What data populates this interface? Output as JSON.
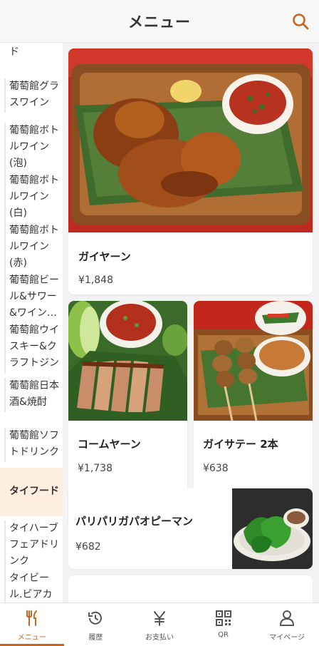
{
  "header": {
    "title": "メニュー",
    "search_icon": "search-icon"
  },
  "colors": {
    "accent": "#c8651e",
    "active_bg": "#fdeee0"
  },
  "sidebar": {
    "items": [
      {
        "label": "ド"
      },
      {
        "label": "葡萄館グラスワイン"
      },
      {
        "label": "葡萄館ボトルワイン(泡)"
      },
      {
        "label": "葡萄館ボトルワイン(白)"
      },
      {
        "label": "葡萄館ボトルワイン(赤)"
      },
      {
        "label": "葡萄館ビール&サワー&ワイン…"
      },
      {
        "label": "葡萄館ウイスキー&クラフトジン"
      },
      {
        "label": "葡萄館日本酒&焼酎"
      },
      {
        "label": "葡萄館ソフトドリンク"
      },
      {
        "label": "タイフード"
      },
      {
        "label": "タイハーブフェアドリンク"
      },
      {
        "label": "タイビール.ビアカ"
      }
    ]
  },
  "menu_items": [
    {
      "name": "ガイヤーン",
      "price": "¥1,848"
    },
    {
      "name": "コームヤーン",
      "price": "¥1,738"
    },
    {
      "name": "ガイサテー 2本",
      "price": "¥638"
    },
    {
      "name": "パリパリガパオピーマン",
      "price": "¥682"
    }
  ],
  "tabbar": {
    "tabs": [
      {
        "label": "メニュー",
        "icon": "fork-knife-icon"
      },
      {
        "label": "履歴",
        "icon": "history-icon"
      },
      {
        "label": "お支払い",
        "icon": "yen-icon"
      },
      {
        "label": "QR",
        "icon": "qr-code-icon"
      },
      {
        "label": "マイページ",
        "icon": "user-icon"
      }
    ]
  }
}
